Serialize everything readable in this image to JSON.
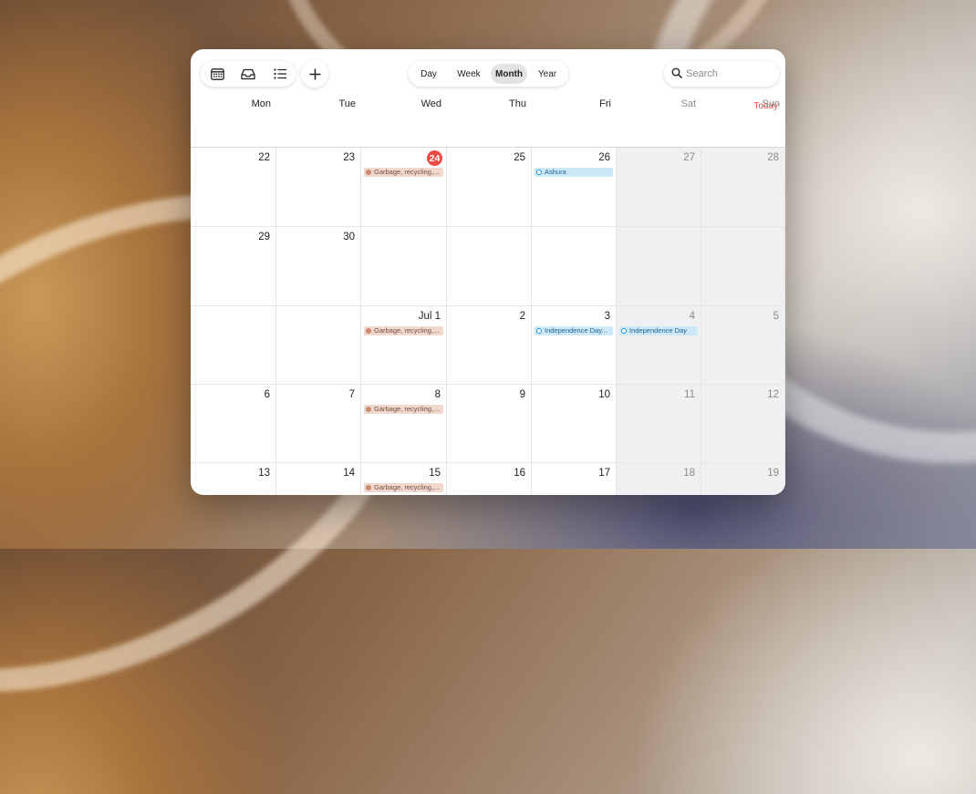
{
  "toolbar": {
    "icons": [
      "calendar-icon",
      "inbox-icon",
      "list-icon",
      "plus-icon"
    ],
    "views": [
      "Day",
      "Week",
      "Month",
      "Year"
    ],
    "active_view": "Month",
    "search_placeholder": "Search",
    "today_label": "Today"
  },
  "weekdays": [
    "Mon",
    "Tue",
    "Wed",
    "Thu",
    "Fri",
    "Sat",
    "Sun"
  ],
  "weeks": [
    [
      {
        "day": "22",
        "event": null
      },
      {
        "day": "23",
        "event": null
      },
      {
        "day": "24",
        "today": true,
        "event": {
          "title": "Garbage, recycling,...",
          "kind": "garbage"
        }
      },
      {
        "day": "25",
        "event": null
      },
      {
        "day": "26",
        "event": {
          "title": "Ashura",
          "kind": "holiday"
        }
      },
      {
        "day": "27",
        "event": null
      },
      {
        "day": "28",
        "event": null
      }
    ],
    [
      {
        "day": "29",
        "event": null
      },
      {
        "day": "30",
        "event": null
      },
      {
        "day": "",
        "event": null
      },
      {
        "day": "",
        "event": null
      },
      {
        "day": "",
        "event": null
      },
      {
        "day": "",
        "event": null
      },
      {
        "day": "",
        "event": null
      }
    ],
    [
      {
        "day": "",
        "event": null
      },
      {
        "day": "",
        "event": null
      },
      {
        "day": "Jul 1",
        "event": {
          "title": "Garbage, recycling,...",
          "kind": "garbage"
        }
      },
      {
        "day": "2",
        "event": null
      },
      {
        "day": "3",
        "event": {
          "title": "Independence Day...",
          "kind": "holiday"
        }
      },
      {
        "day": "4",
        "event": {
          "title": "Independence Day",
          "kind": "holiday"
        }
      },
      {
        "day": "5",
        "event": null
      }
    ],
    [
      {
        "day": "6",
        "event": null
      },
      {
        "day": "7",
        "event": null
      },
      {
        "day": "8",
        "event": {
          "title": "Garbage, recycling,...",
          "kind": "garbage"
        }
      },
      {
        "day": "9",
        "event": null
      },
      {
        "day": "10",
        "event": null
      },
      {
        "day": "11",
        "event": null
      },
      {
        "day": "12",
        "event": null
      }
    ],
    [
      {
        "day": "13",
        "event": null
      },
      {
        "day": "14",
        "event": null
      },
      {
        "day": "15",
        "event": {
          "title": "Garbage, recycling,...",
          "kind": "garbage"
        }
      },
      {
        "day": "16",
        "event": null
      },
      {
        "day": "17",
        "event": null
      },
      {
        "day": "18",
        "event": null
      },
      {
        "day": "19",
        "event": null
      }
    ]
  ],
  "colors": {
    "today_accent": "#ee4a43",
    "garbage_event": "#efd9cf",
    "holiday_event": "#cde9f8"
  }
}
